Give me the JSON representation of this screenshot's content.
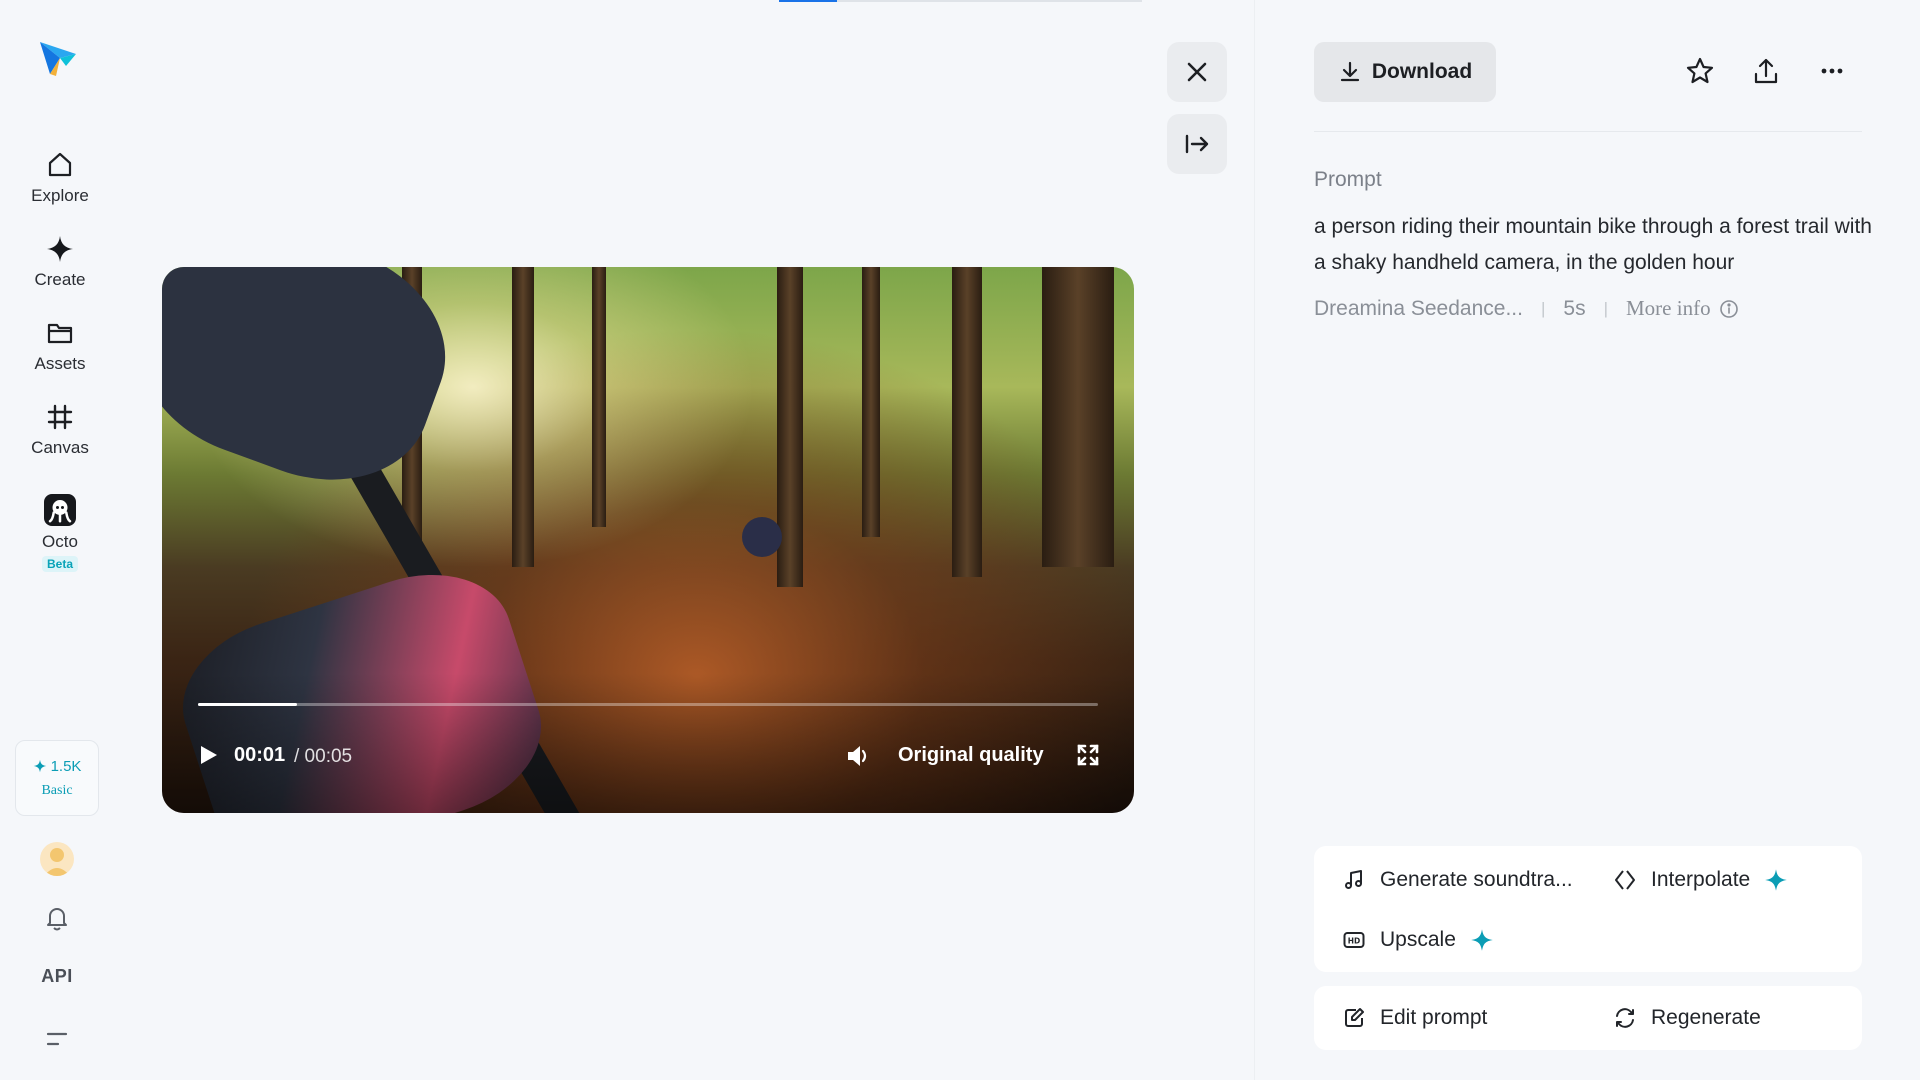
{
  "sidebar": {
    "nav": [
      {
        "label": "Explore",
        "icon": "home-icon"
      },
      {
        "label": "Create",
        "icon": "sparkle-icon"
      },
      {
        "label": "Assets",
        "icon": "folder-icon"
      },
      {
        "label": "Canvas",
        "icon": "canvas-icon"
      },
      {
        "label": "Octo",
        "icon": "octo-icon",
        "badge": "Beta"
      }
    ],
    "credits": {
      "amount": "1.5K",
      "plan": "Basic"
    },
    "api_label": "API"
  },
  "top_progress": 0.16,
  "video": {
    "current_time": "00:01",
    "duration": "/ 00:05",
    "progress": 0.11,
    "quality": "Original quality"
  },
  "panel": {
    "download_label": "Download",
    "prompt_heading": "Prompt",
    "prompt_text": "a person riding their mountain bike through a forest trail with a shaky handheld camera, in the golden hour",
    "model": "Dreamina Seedance...",
    "length": "5s",
    "more_info": "More info",
    "actions": {
      "soundtrack": "Generate soundtra...",
      "interpolate": "Interpolate",
      "upscale": "Upscale",
      "edit_prompt": "Edit prompt",
      "regenerate": "Regenerate"
    }
  },
  "colors": {
    "accent": "#0b9db5",
    "progress_blue": "#1a73e8",
    "background": "#f5f7fa"
  }
}
